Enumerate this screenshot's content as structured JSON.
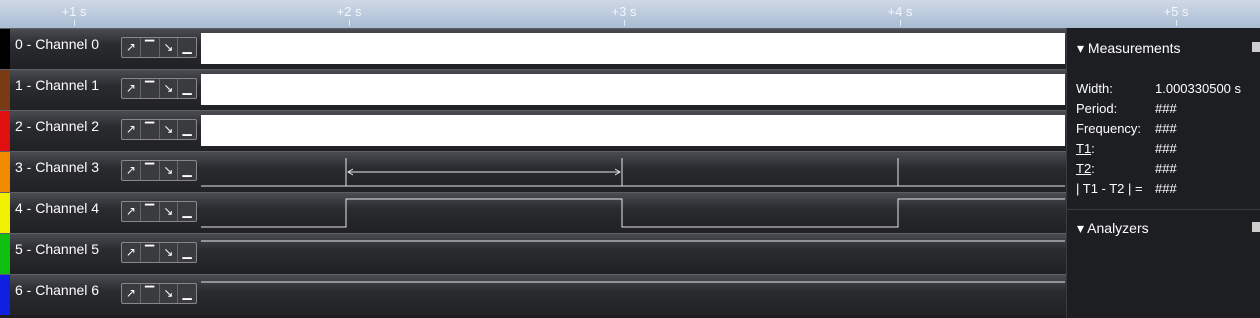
{
  "timeline": {
    "ticks": [
      "+1 s",
      "+2 s",
      "+3 s",
      "+4 s",
      "+5 s"
    ]
  },
  "channels": [
    {
      "label": "0 - Channel 0",
      "color": "#000000"
    },
    {
      "label": "1 - Channel 1",
      "color": "#7a3a14"
    },
    {
      "label": "2 - Channel 2",
      "color": "#e01010"
    },
    {
      "label": "3 - Channel 3",
      "color": "#f08a00"
    },
    {
      "label": "4 - Channel 4",
      "color": "#f0f000"
    },
    {
      "label": "5 - Channel 5",
      "color": "#10c010"
    },
    {
      "label": "6 - Channel 6",
      "color": "#1020e0"
    }
  ],
  "trigger_buttons": {
    "rising": "↗",
    "high": "▔",
    "falling": "↘",
    "low": "▁"
  },
  "sidebar": {
    "measurements_title": "Measurements",
    "measurements": [
      {
        "label": "Width:",
        "value": "1.000330500 s"
      },
      {
        "label": "Period:",
        "value": "###"
      },
      {
        "label": "Frequency:",
        "value": "###"
      },
      {
        "label": "T1",
        "suffix": ":",
        "value": "###"
      },
      {
        "label": "T2",
        "suffix": ":",
        "value": "###"
      },
      {
        "label": "| T1 - T2 | =",
        "value": "###"
      }
    ],
    "analyzers_title": "Analyzers"
  },
  "colors": {
    "accent": "#ffffff",
    "background": "#1c1d20"
  }
}
